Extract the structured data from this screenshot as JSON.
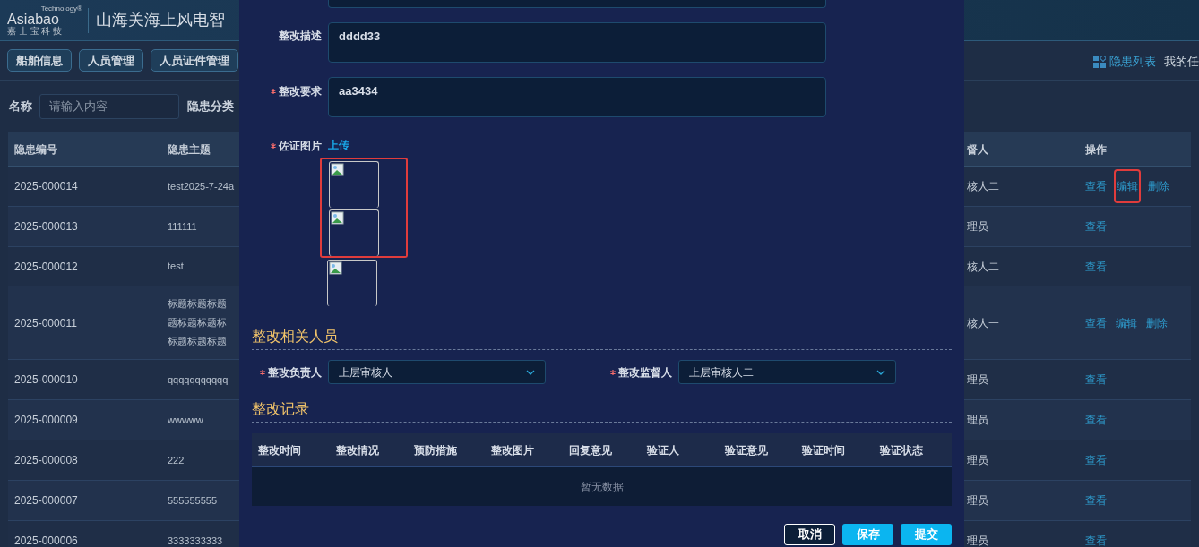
{
  "header": {
    "logo": {
      "brand": "Asiabao",
      "tagline": "Technology®",
      "subtitle": "嘉 士 宝 科 技"
    },
    "title": "山海关海上风电智"
  },
  "nav": [
    {
      "label": "船舶信息"
    },
    {
      "label": "人员管理"
    },
    {
      "label": "人员证件管理"
    }
  ],
  "header_links": [
    {
      "label": "隐患列表",
      "selected": true
    },
    {
      "label": "我的任",
      "selected": false
    }
  ],
  "filters": [
    {
      "label": "名称",
      "placeholder": "请输入内容"
    },
    {
      "label": "隐患分类"
    }
  ],
  "table": {
    "columns": [
      "隐患编号",
      "隐患主题",
      "督人",
      "操作"
    ],
    "rows": [
      {
        "id": "2025-000014",
        "subject": [
          "test2025-7-24a"
        ],
        "supervisor": "核人二",
        "actions": [
          {
            "label": "查看",
            "highlighted": false
          },
          {
            "label": "编辑",
            "highlighted": true
          },
          {
            "label": "删除",
            "highlighted": false
          }
        ]
      },
      {
        "id": "2025-000013",
        "subject": [
          "111111"
        ],
        "supervisor": "理员",
        "actions": [
          {
            "label": "查看",
            "highlighted": false
          }
        ]
      },
      {
        "id": "2025-000012",
        "subject": [
          "test"
        ],
        "supervisor": "核人二",
        "actions": [
          {
            "label": "查看",
            "highlighted": false
          }
        ]
      },
      {
        "id": "2025-000011",
        "subject": [
          "标题标题标题",
          "题标题标题标",
          "标题标题标题"
        ],
        "supervisor": "核人一",
        "actions": [
          {
            "label": "查看",
            "highlighted": false
          },
          {
            "label": "编辑",
            "highlighted": false
          },
          {
            "label": "删除",
            "highlighted": false
          }
        ]
      },
      {
        "id": "2025-000010",
        "subject": [
          "qqqqqqqqqqq"
        ],
        "supervisor": "理员",
        "actions": [
          {
            "label": "查看",
            "highlighted": false
          }
        ]
      },
      {
        "id": "2025-000009",
        "subject": [
          "wwwww"
        ],
        "supervisor": "理员",
        "actions": [
          {
            "label": "查看",
            "highlighted": false
          }
        ]
      },
      {
        "id": "2025-000008",
        "subject": [
          "222"
        ],
        "supervisor": "理员",
        "actions": [
          {
            "label": "查看",
            "highlighted": false
          }
        ]
      },
      {
        "id": "2025-000007",
        "subject": [
          "555555555"
        ],
        "supervisor": "理员",
        "actions": [
          {
            "label": "查看",
            "highlighted": false
          }
        ]
      },
      {
        "id": "2025-000006",
        "subject": [
          "3333333333"
        ],
        "supervisor": "理员",
        "actions": [
          {
            "label": "查看",
            "highlighted": false
          }
        ]
      }
    ]
  },
  "dialog": {
    "fields": [
      {
        "label": "整改描述",
        "required": false,
        "value": "dddd33"
      },
      {
        "label": "整改要求",
        "required": true,
        "value": "aa3434"
      }
    ],
    "evidence": {
      "label": "佐证图片",
      "required": true,
      "upload": "上传",
      "images": [
        {
          "highlighted": true
        },
        {
          "highlighted": true
        },
        {
          "highlighted": false
        }
      ]
    },
    "people_section": "整改相关人员",
    "people": [
      {
        "label": "整改负责人",
        "required": true,
        "value": "上层审核人一"
      },
      {
        "label": "整改监督人",
        "required": true,
        "value": "上层审核人二"
      }
    ],
    "records_section": "整改记录",
    "records": {
      "columns": [
        "整改时间",
        "整改情况",
        "预防措施",
        "整改图片",
        "回复意见",
        "验证人",
        "验证意见",
        "验证时间",
        "验证状态"
      ],
      "empty": "暂无数据"
    },
    "buttons": [
      {
        "label": "取消",
        "kind": "outline"
      },
      {
        "label": "保存",
        "kind": "primary"
      },
      {
        "label": "提交",
        "kind": "primary"
      }
    ]
  }
}
